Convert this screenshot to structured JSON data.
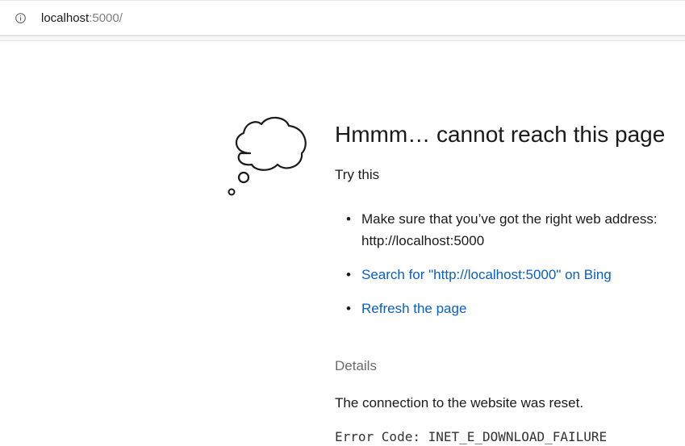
{
  "address_bar": {
    "icon": "info-icon",
    "url_host": "localhost",
    "url_rest": ":5000/"
  },
  "illustration": {
    "icon": "thought-cloud-icon"
  },
  "main": {
    "title": "Hmmm… cannot reach this page",
    "try_this": "Try this",
    "suggestions": [
      {
        "type": "text",
        "text": "Make sure that you’ve got the right web address: http://localhost:5000"
      },
      {
        "type": "link",
        "text": "Search for \"http://localhost:5000\" on Bing"
      },
      {
        "type": "link",
        "text": "Refresh the page"
      }
    ],
    "bullet": "•",
    "details_label": "Details",
    "details_text": "The connection to the website was reset.",
    "error_code": "Error Code: INET_E_DOWNLOAD_FAILURE"
  },
  "colors": {
    "link": "#0a5fc2",
    "muted": "#6b6b6b",
    "text": "#1a1a1a"
  }
}
